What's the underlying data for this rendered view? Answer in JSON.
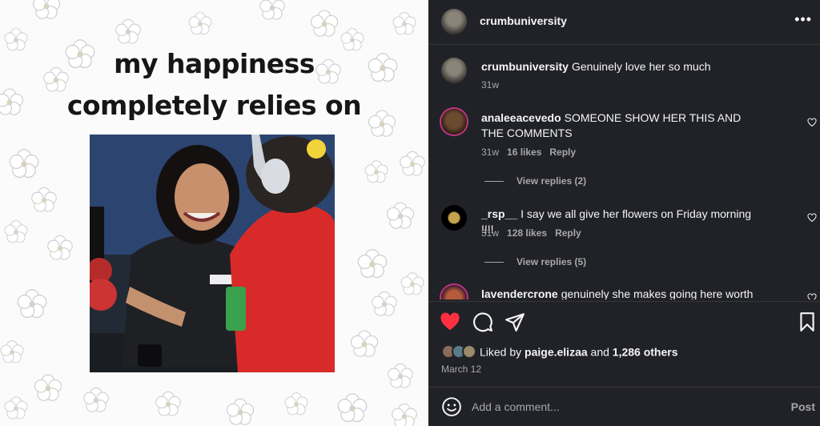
{
  "post": {
    "headline_line1": "my happiness",
    "headline_line2": "completely relies on"
  },
  "header": {
    "username": "crumbuniversity",
    "more_icon": "more-horizontal-icon",
    "more_label": "•••"
  },
  "comments": [
    {
      "username": "crumbuniversity",
      "text": "Genuinely love her so much",
      "time": "31w"
    },
    {
      "username": "analeeacevedo",
      "text": "SOMEONE SHOW HER THIS AND THE COMMENTS",
      "time": "31w",
      "likes": "16 likes",
      "reply": "Reply",
      "view_replies": "View replies (2)"
    },
    {
      "username": "_rsp__",
      "text": "I say we all give her flowers on Friday morning !!!!",
      "time": "31w",
      "likes": "128 likes",
      "reply": "Reply",
      "view_replies": "View replies (5)"
    },
    {
      "username": "lavendercrone",
      "text": "genuinely she makes going here worth it"
    }
  ],
  "actions": {
    "like_icon": "heart-filled-icon",
    "comment_icon": "comment-icon",
    "share_icon": "send-icon",
    "save_icon": "bookmark-icon"
  },
  "likes": {
    "prefix": "Liked by ",
    "user": "paige.elizaa",
    "connector": " and ",
    "others": "1,286 others"
  },
  "date": "March 12",
  "add_comment": {
    "placeholder": "Add a comment...",
    "post_label": "Post",
    "emoji_icon": "emoji-icon"
  },
  "colors": {
    "panel_bg": "#212228",
    "like_red": "#ff3040",
    "muted_text": "#a8a8a8"
  }
}
